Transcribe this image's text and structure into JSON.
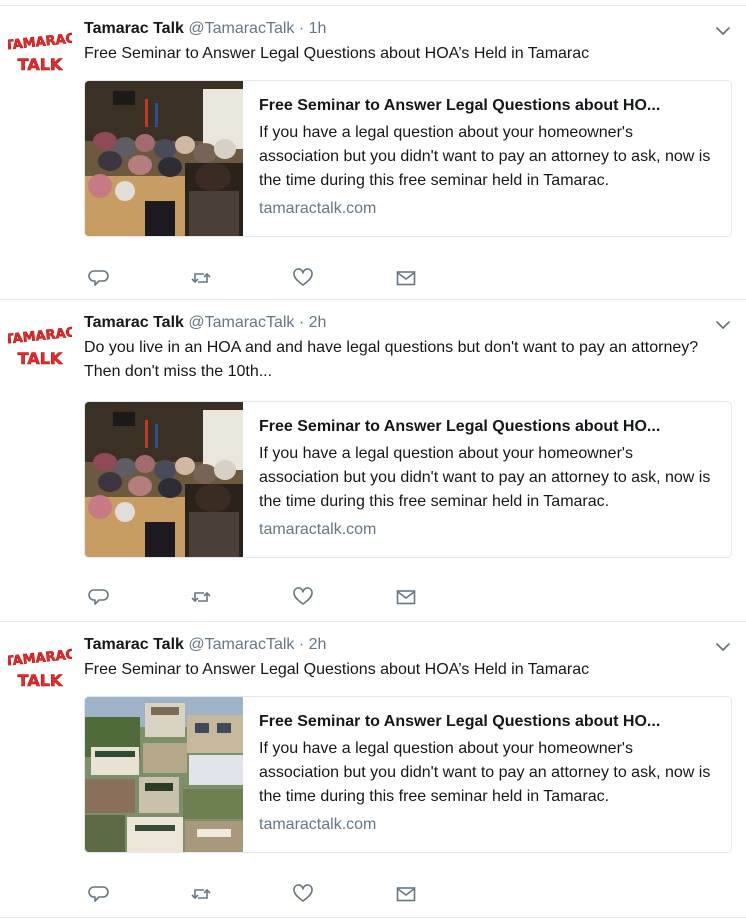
{
  "colors": {
    "text": "#14171a",
    "secondary": "#657786",
    "border": "#e6ecf0",
    "avatar_red": "#e32b2b"
  },
  "icons": {
    "reply": "reply-icon",
    "retweet": "retweet-icon",
    "like": "heart-icon",
    "dm": "envelope-icon",
    "menu": "chevron-down-icon"
  },
  "tweets": [
    {
      "name": "Tamarac Talk",
      "handle": "@TamaracTalk",
      "dot": "·",
      "time": "1h",
      "text": "Free Seminar to Answer Legal Questions about HOA’s Held in Tamarac",
      "card": {
        "title": "Free Seminar to Answer Legal Questions about HO...",
        "description": "If you have a legal question about your homeowner's association but you didn't want to pay an attorney to ask, now is the time during this free seminar held in Tamarac.",
        "domain": "tamaractalk.com",
        "image": "seminar-photo"
      }
    },
    {
      "name": "Tamarac Talk",
      "handle": "@TamaracTalk",
      "dot": "·",
      "time": "2h",
      "text": "Do you live in an HOA and and have legal questions but don't want to pay an attorney?  Then don't miss the 10th...",
      "card": {
        "title": "Free Seminar to Answer Legal Questions about HO...",
        "description": "If you have a legal question about your homeowner's association but you didn't want to pay an attorney to ask, now is the time during this free seminar held in Tamarac.",
        "domain": "tamaractalk.com",
        "image": "seminar-photo"
      }
    },
    {
      "name": "Tamarac Talk",
      "handle": "@TamaracTalk",
      "dot": "·",
      "time": "2h",
      "text": "Free Seminar to Answer Legal Questions about HOA’s Held in Tamarac",
      "card": {
        "title": "Free Seminar to Answer Legal Questions about HO...",
        "description": "If you have a legal question about your homeowner's association but you didn't want to pay an attorney to ask, now is the time during this free seminar held in Tamarac.",
        "domain": "tamaractalk.com",
        "image": "community-collage"
      }
    }
  ]
}
